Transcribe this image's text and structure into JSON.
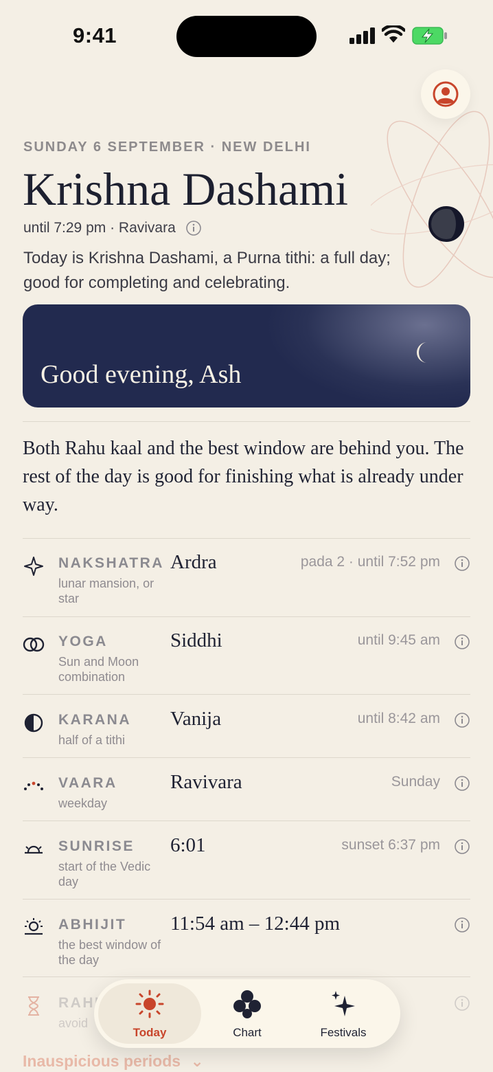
{
  "status": {
    "time": "9:41"
  },
  "header": {
    "date_line": "SUNDAY 6 SEPTEMBER · NEW DELHI",
    "title": "Krishna Dashami",
    "until": "until 7:29 pm · Ravivara",
    "description": "Today is Krishna Dashami, a Purna tithi: a full day; good for completing and celebrating."
  },
  "greeting": {
    "text": "Good evening, Ash"
  },
  "summary": "Both Rahu kaal and the best window are behind you. The rest of the day is good for finishing what is already under way.",
  "rows": [
    {
      "label": "NAKSHATRA",
      "sub": "lunar mansion, or star",
      "value": "Ardra",
      "meta": "pada 2 · until 7:52 pm",
      "icon": "star-icon"
    },
    {
      "label": "YOGA",
      "sub": "Sun and Moon combination",
      "value": "Siddhi",
      "meta": "until 9:45 am",
      "icon": "rings-icon"
    },
    {
      "label": "KARANA",
      "sub": "half of a tithi",
      "value": "Vanija",
      "meta": "until 8:42 am",
      "icon": "half-circle-icon"
    },
    {
      "label": "VAARA",
      "sub": "weekday",
      "value": "Ravivara",
      "meta": "Sunday",
      "icon": "dots-arc-icon"
    },
    {
      "label": "SUNRISE",
      "sub": "start of the Vedic day",
      "value": "6:01",
      "meta": "sunset 6:37 pm",
      "icon": "sunrise-icon"
    },
    {
      "label": "ABHIJIT",
      "sub": "the best window of the day",
      "value": "11:54 am – 12:44 pm",
      "meta": "",
      "icon": "sun-horizon-icon"
    },
    {
      "label": "RAHU",
      "sub": "avoid",
      "value": "",
      "meta": "",
      "icon": "hourglass-icon"
    }
  ],
  "inauspicious": {
    "label": "Inauspicious periods"
  },
  "tabs": [
    {
      "label": "Today",
      "icon": "sun-icon",
      "active": true
    },
    {
      "label": "Chart",
      "icon": "chart-dots-icon",
      "active": false
    },
    {
      "label": "Festivals",
      "icon": "sparkle-icon",
      "active": false
    }
  ],
  "colors": {
    "accent": "#c8452b",
    "navy": "#222a4f",
    "background": "#f4efe5"
  }
}
